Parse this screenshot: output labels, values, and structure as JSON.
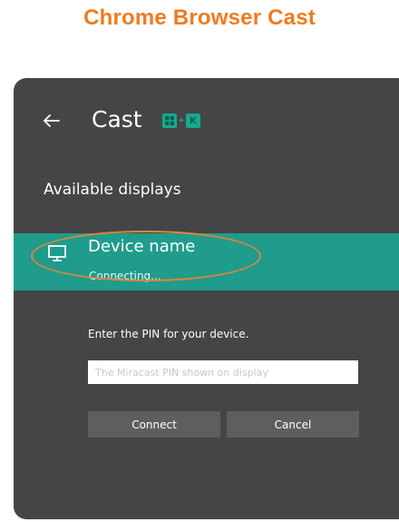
{
  "page": {
    "heading": "Chrome Browser Cast"
  },
  "panel": {
    "title": "Cast",
    "shortcut": {
      "key1": "⊞",
      "plus": "+",
      "key2": "K"
    },
    "section_title": "Available displays",
    "device": {
      "name": "Device name",
      "status": "Connecting..."
    },
    "pin": {
      "prompt": "Enter the PIN for your device.",
      "placeholder": "The Miracast PIN shown on display"
    },
    "buttons": {
      "connect": "Connect",
      "cancel": "Cancel"
    }
  },
  "colors": {
    "heading": "#f07b1e",
    "panel_bg": "#454545",
    "selected_row": "#1f9c8b",
    "accent_keycap": "#17a88e",
    "highlight_ring": "#e0843a",
    "button_bg": "#5e5e5e"
  },
  "icons": {
    "back": "back-arrow-icon",
    "device": "monitor-icon",
    "windows_key": "windows-key-icon"
  }
}
